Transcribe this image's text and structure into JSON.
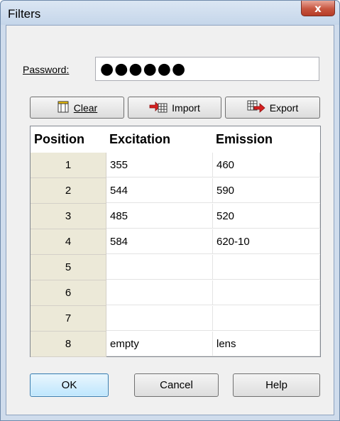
{
  "window": {
    "title": "Filters",
    "close_symbol": "x"
  },
  "password": {
    "label": "Password:",
    "value": "●●●●●●"
  },
  "toolbar": {
    "clear_label": "Clear",
    "import_label": "Import",
    "export_label": "Export"
  },
  "table": {
    "headers": {
      "position": "Position",
      "excitation": "Excitation",
      "emission": "Emission"
    },
    "rows": [
      {
        "position": "1",
        "excitation": "355",
        "emission": "460"
      },
      {
        "position": "2",
        "excitation": "544",
        "emission": "590"
      },
      {
        "position": "3",
        "excitation": "485",
        "emission": "520"
      },
      {
        "position": "4",
        "excitation": "584",
        "emission": "620-10"
      },
      {
        "position": "5",
        "excitation": "",
        "emission": ""
      },
      {
        "position": "6",
        "excitation": "",
        "emission": ""
      },
      {
        "position": "7",
        "excitation": "",
        "emission": ""
      },
      {
        "position": "8",
        "excitation": "empty",
        "emission": "lens"
      }
    ]
  },
  "buttons": {
    "ok": "OK",
    "cancel": "Cancel",
    "help": "Help"
  }
}
